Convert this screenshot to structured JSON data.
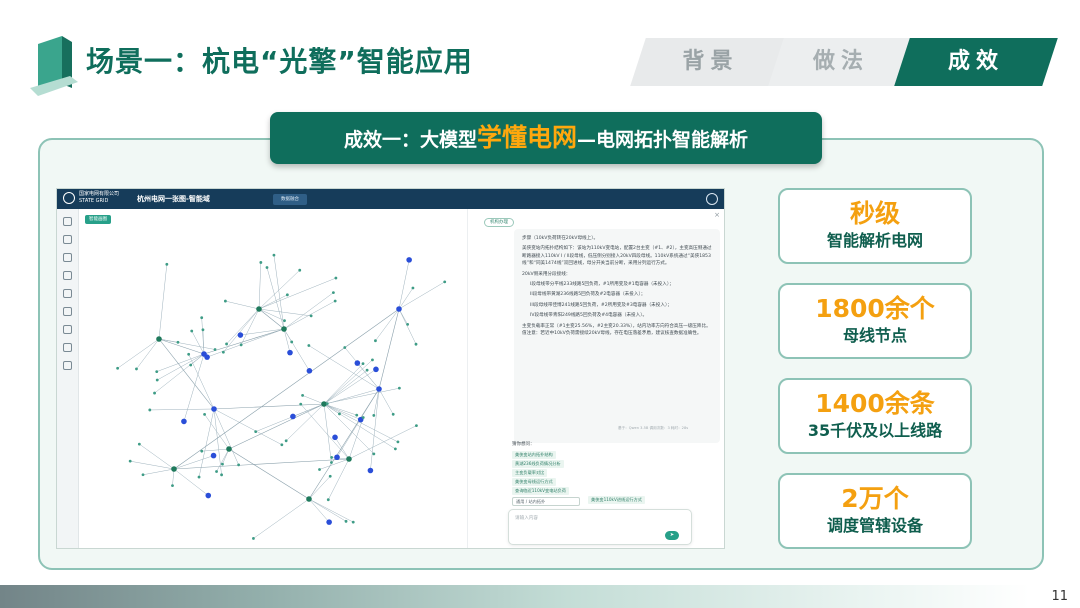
{
  "header": {
    "title": "场景一：杭电“光擎”智能应用",
    "tabs": [
      {
        "label": "背景",
        "active": false
      },
      {
        "label": "做法",
        "active": false
      },
      {
        "label": "成效",
        "active": true
      }
    ]
  },
  "banner": {
    "prefix": "成效一：大模型",
    "highlight": "学懂电网",
    "suffix": "—电网拓扑智能解析"
  },
  "app": {
    "org_line1": "国家电网有限公司",
    "org_line2": "STATE GRID",
    "title": "杭州电网一张图-智能域",
    "top_tab": "数据融合",
    "graph_tag": "智能画图",
    "chat_pill": "机构办理",
    "chat_close": "×",
    "chat_lines": [
      "步骤（10kV负荷转在20kV母线上）。",
      "美侠变站内拓扑结构如下：该站为110kV变电站，配置2台主变（#1、#2），主变高压侧通过断路器接入110kV I / II段母线，低压侧分别接入20kV四段母线。110kV系统通过“美侠1853线”和“同美1474线”双回进线，母分开关当前分断，采用分列运行方式。",
      "20kV侧采用分段接线：",
      "I段母线带分平线233线路5回负荷，#1所用变及#1电容器（未投入）；",
      "II段母线带黄湖236线路5回负荷及#2电容器（未投入）；",
      "III段母线带佳博241线路5回负荷，#2所用变及#3电容器（未投入）；",
      "IV段母线带青阳249线路5回负荷及#4电容器（未投入）。",
      "主变负载率正常（#1主变25.56%，#2主变20.33%），站内功率方向符合高压一级压降比。值注意：若近中10kV负荷需接续20kV母线，存在电压落差矛盾，建议核查数据准确性。"
    ],
    "chat_meta": "基于：Qwen 3.5B 调用次数：3 耗时：28s",
    "suggest_label": "猜你想问：",
    "suggestions": [
      "美侠变站内拓扑结构",
      "黄湖236线负荷情况分析",
      "主变负载率对比",
      "美侠变母线运行方式",
      "查询临近110kV变电站负荷",
      "美侠变110kV进线运行方式"
    ],
    "select_value": "通用 / 站内拓扑",
    "input_placeholder": "请输入内容",
    "send_label": "➤"
  },
  "stats": [
    {
      "value": "秒级",
      "label": "智能解析电网"
    },
    {
      "value": "1800余个",
      "label": "母线节点"
    },
    {
      "value": "1400余条",
      "label": "35千伏及以上线路"
    },
    {
      "value": "2万个",
      "label": "调度管辖设备"
    }
  ],
  "page_number": "11",
  "colors": {
    "brand": "#0f6e5c",
    "accent": "#f4a010",
    "banner_highlight": "#ffa80d",
    "node_blue": "#2a4ed8",
    "node_green": "#1f7a5c"
  }
}
